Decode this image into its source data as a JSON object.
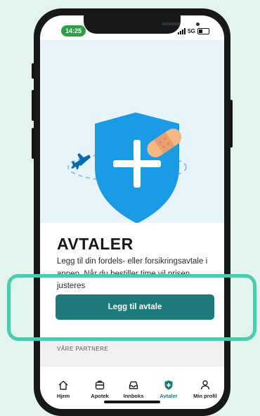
{
  "status_bar": {
    "time": "14:25",
    "network": "5G",
    "battery_level": 0.4
  },
  "page": {
    "title": "AVTALER",
    "description": "Legg til din fordels- eller forsikringsavtale i appen. Når du bestiller time vil prisen justeres",
    "cta_label": "Legg til avtale",
    "partners_label": "VÅRE PARTNERE"
  },
  "tabs": [
    {
      "label": "Hjem",
      "icon": "home-icon",
      "active": false
    },
    {
      "label": "Apotek",
      "icon": "pharmacy-icon",
      "active": false
    },
    {
      "label": "Innboks",
      "icon": "inbox-icon",
      "active": false
    },
    {
      "label": "Avtaler",
      "icon": "agreements-icon",
      "active": true
    },
    {
      "label": "Min profil",
      "icon": "profile-icon",
      "active": false
    }
  ],
  "colors": {
    "background": "#e3f4ee",
    "accent": "#1f7a7d",
    "shield": "#1a9be3",
    "highlight": "#4ccbb0",
    "status_pill": "#2e9f47"
  }
}
